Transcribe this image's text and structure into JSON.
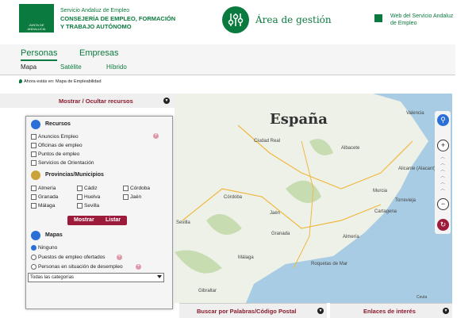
{
  "header": {
    "logo_text": "JUNTA DE ANDALUCIA",
    "org_top": "Servicio Andaluz de Empleo",
    "org_name": "CONSEJERÍA DE EMPLEO, FORMACIÓN Y TRABAJO AUTÓNOMO",
    "mgmt_title": "Área de gestión",
    "web_link": "Web del Servicio Andaluz de Empleo"
  },
  "nav": {
    "tabs": [
      "Personas",
      "Empresas"
    ],
    "subtabs": [
      "Mapa",
      "Satélite",
      "Híbrido"
    ]
  },
  "breadcrumb": "Ahora estás en: Mapa de Empleabilidad",
  "toggle_label": "Mostrar / Ocultar recursos",
  "panel": {
    "recursos_title": "Recursos",
    "recursos": [
      "Anuncios Empleo",
      "Oficinas de empleo",
      "Puntos de empleo",
      "Servicios de Orientación"
    ],
    "provincias_title": "Provincias/Municipios",
    "provincias": [
      "Almería",
      "Cádiz",
      "Córdoba",
      "Granada",
      "Huelva",
      "Jaén",
      "Málaga",
      "Sevilla"
    ],
    "btn_mostrar": "Mostrar",
    "btn_listar": "Listar",
    "mapas_title": "Mapas",
    "mapas": [
      "Ninguno",
      "Puestos de empleo ofertados",
      "Personas en situación de desempleo"
    ],
    "select_value": "Todas las categorías"
  },
  "map": {
    "country": "España",
    "cities": [
      "Valencia",
      "Ciudad Real",
      "Albacete",
      "Alicante (Alacant)",
      "Córdoba",
      "Murcia",
      "Jaén",
      "Torrevieja",
      "Cartagena",
      "Sevilla",
      "Granada",
      "Almería",
      "Málaga",
      "Roquetas de Mar",
      "Gibraltar",
      "Ceuta"
    ]
  },
  "bottom": {
    "search_label": "Buscar por Palabras/Código Postal",
    "links_label": "Enlaces de interés"
  }
}
